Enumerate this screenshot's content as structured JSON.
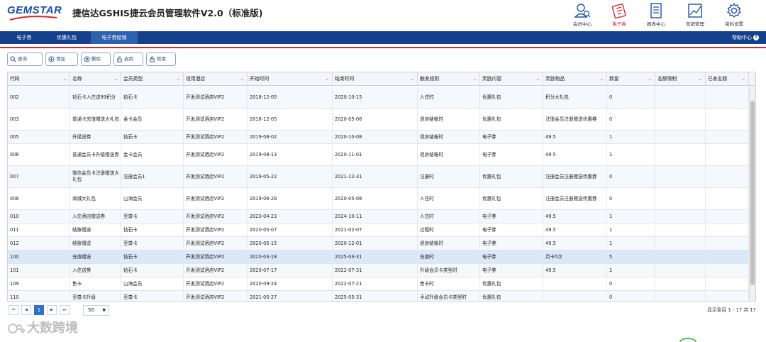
{
  "header": {
    "logo": "GEMSTAR",
    "title": "捷信达GSHIS捷云会员管理软件V2.0（标准版)",
    "icons": [
      {
        "label": "会员中心",
        "icon": "member-center-icon"
      },
      {
        "label": "电子券",
        "icon": "coupon-icon"
      },
      {
        "label": "报表中心",
        "icon": "report-icon"
      },
      {
        "label": "营销管理",
        "icon": "marketing-chart-icon"
      },
      {
        "label": "资料设置",
        "icon": "gear-icon"
      }
    ],
    "active_color": "#d9262c"
  },
  "nav": {
    "tabs": [
      {
        "label": "电子券"
      },
      {
        "label": "优惠礼包"
      },
      {
        "label": "电子券促销"
      }
    ],
    "help": "帮助中心",
    "bar_color": "#14408e"
  },
  "toolbar": {
    "buttons": [
      {
        "label": "查询",
        "icon": "search-icon"
      },
      {
        "label": "增加",
        "icon": "plus-icon"
      },
      {
        "label": "删除",
        "icon": "close-icon"
      },
      {
        "label": "启用",
        "icon": "enable-icon"
      },
      {
        "label": "禁用",
        "icon": "lock-icon"
      }
    ]
  },
  "table": {
    "columns": [
      "代码",
      "名称",
      "会员类型",
      "适用酒店",
      "开始时间",
      "结束时间",
      "触发规则",
      "奖励内容",
      "奖励物品",
      "数量",
      "名额限制",
      "已发名额"
    ],
    "rows": [
      [
        "002",
        "钻石卡入住送99积分",
        "钻石卡",
        "开发测试酒店VIP2",
        "2018-12-05",
        "2020-10-15",
        "入住时",
        "优惠礼包",
        "积分大礼包",
        "0",
        "",
        ""
      ],
      [
        "003",
        "普通卡充值赠送大礼包",
        "金卡会员",
        "开发测试酒店VIP2",
        "2018-12-05",
        "2020-05-06",
        "退房结帐时",
        "优惠礼包",
        "注册会员注册赠送优惠券",
        "0",
        "",
        ""
      ],
      [
        "005",
        "升级送券",
        "钻石卡",
        "开发测试酒店VIP2",
        "2019-08-02",
        "2020-10-08",
        "退房结帐时",
        "电子券",
        "49.5",
        "1",
        "",
        ""
      ],
      [
        "006",
        "普通会员卡升级赠送券",
        "金卡会员",
        "开发测试酒店VIP2",
        "2019-08-13",
        "2020-11-01",
        "退房结帐时",
        "电子券",
        "49.5",
        "1",
        "",
        ""
      ],
      [
        "007",
        "微信会员卡注册赠送大礼包",
        "注册会员1",
        "开发测试酒店VIP2",
        "2019-05-22",
        "2021-12-31",
        "注册时",
        "优惠礼包",
        "注册会员注册赠送优惠券",
        "0",
        "",
        ""
      ],
      [
        "008",
        "商城大礼包",
        "山海会员",
        "开发测试酒店VIP2",
        "2019-06-28",
        "2020-05-08",
        "入住时",
        "优惠礼包",
        "注册会员注册赠送优惠券",
        "0",
        "",
        ""
      ],
      [
        "010",
        "入住酒店赠送券",
        "至尊卡",
        "开发测试酒店VIP2",
        "2020-04-23",
        "2024-10-11",
        "入住时",
        "电子券",
        "49.5",
        "1",
        "",
        ""
      ],
      [
        "011",
        "结账赠送",
        "钻石卡",
        "开发测试酒店VIP2",
        "2020-05-07",
        "2021-02-07",
        "过租时",
        "电子券",
        "49.5",
        "1",
        "",
        ""
      ],
      [
        "012",
        "结账赠送",
        "至尊卡",
        "开发测试酒店VIP2",
        "2020-05-15",
        "2020-12-01",
        "退房结帐时",
        "电子券",
        "49.5",
        "1",
        "",
        ""
      ],
      [
        "100",
        "充值赠送",
        "钻石卡",
        "开发测试酒店VIP2",
        "2020-03-18",
        "2025-03-31",
        "充值时",
        "电子券",
        "月卡5次",
        "5",
        "",
        ""
      ],
      [
        "101",
        "入住送券",
        "钻石卡",
        "开发测试酒店VIP2",
        "2020-07-17",
        "2022-07-31",
        "升级会员卡类型时",
        "电子券",
        "49.5",
        "1",
        "",
        ""
      ],
      [
        "109",
        "售卡",
        "山海会员",
        "开发测试酒店VIP2",
        "2020-09-24",
        "2022-07-21",
        "售卡时",
        "优惠礼包",
        "",
        "0",
        "",
        ""
      ],
      [
        "110",
        "至尊卡升级",
        "至尊卡",
        "开发测试酒店VIP2",
        "2021-05-27",
        "2025-05-31",
        "手动升级会员卡类型时",
        "优惠礼包",
        "",
        "0",
        "",
        ""
      ]
    ],
    "selected_row_index": 9
  },
  "pager": {
    "first": "⏮",
    "prev": "◀",
    "current_page": "1",
    "next": "▶",
    "last": "⏭",
    "page_size": "50",
    "info": "显示条目 1 - 17 共 17"
  },
  "watermark": "大数跨境"
}
